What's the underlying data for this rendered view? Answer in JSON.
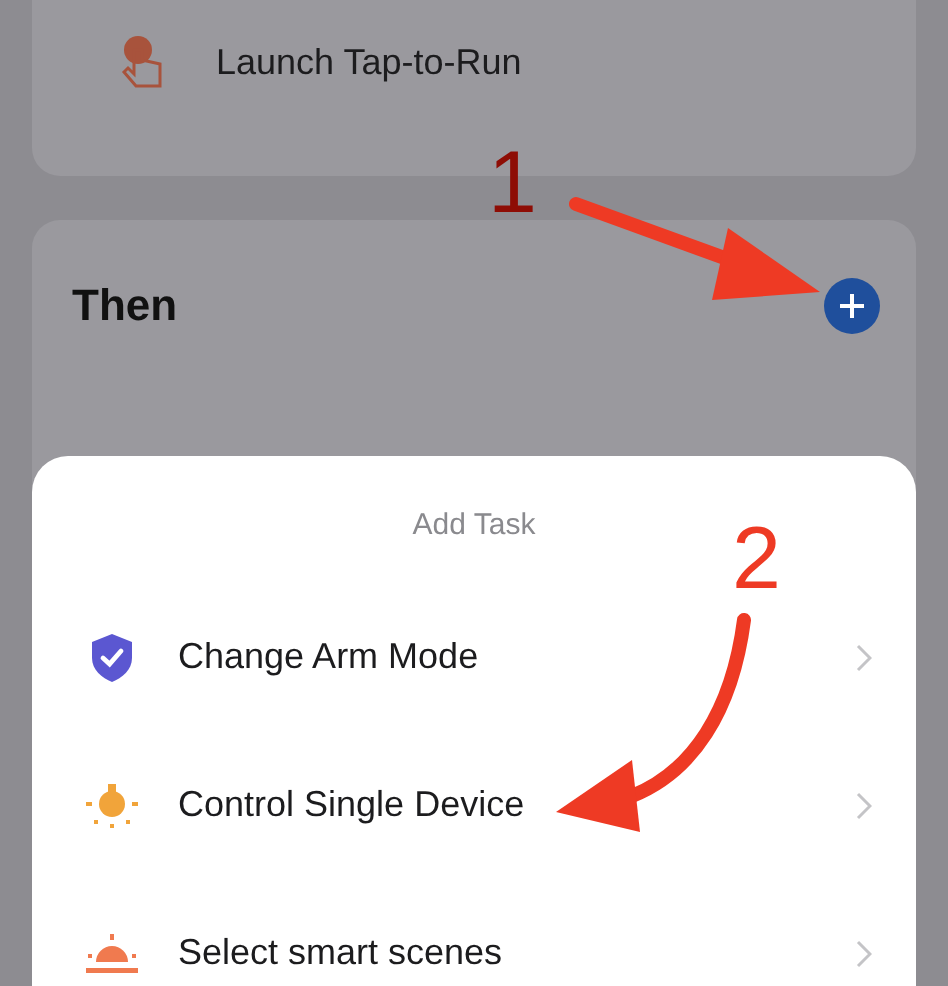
{
  "trigger_item": {
    "label": "Launch Tap-to-Run"
  },
  "then_section": {
    "title": "Then"
  },
  "sheet": {
    "title": "Add Task",
    "items": [
      {
        "kind": "shield",
        "label": "Change Arm Mode"
      },
      {
        "kind": "bulb",
        "label": "Control Single Device"
      },
      {
        "kind": "sunrise",
        "label": "Select smart scenes"
      }
    ]
  },
  "annotations": [
    {
      "kind": "straight",
      "label": "1"
    },
    {
      "kind": "curved",
      "label": "2"
    }
  ]
}
